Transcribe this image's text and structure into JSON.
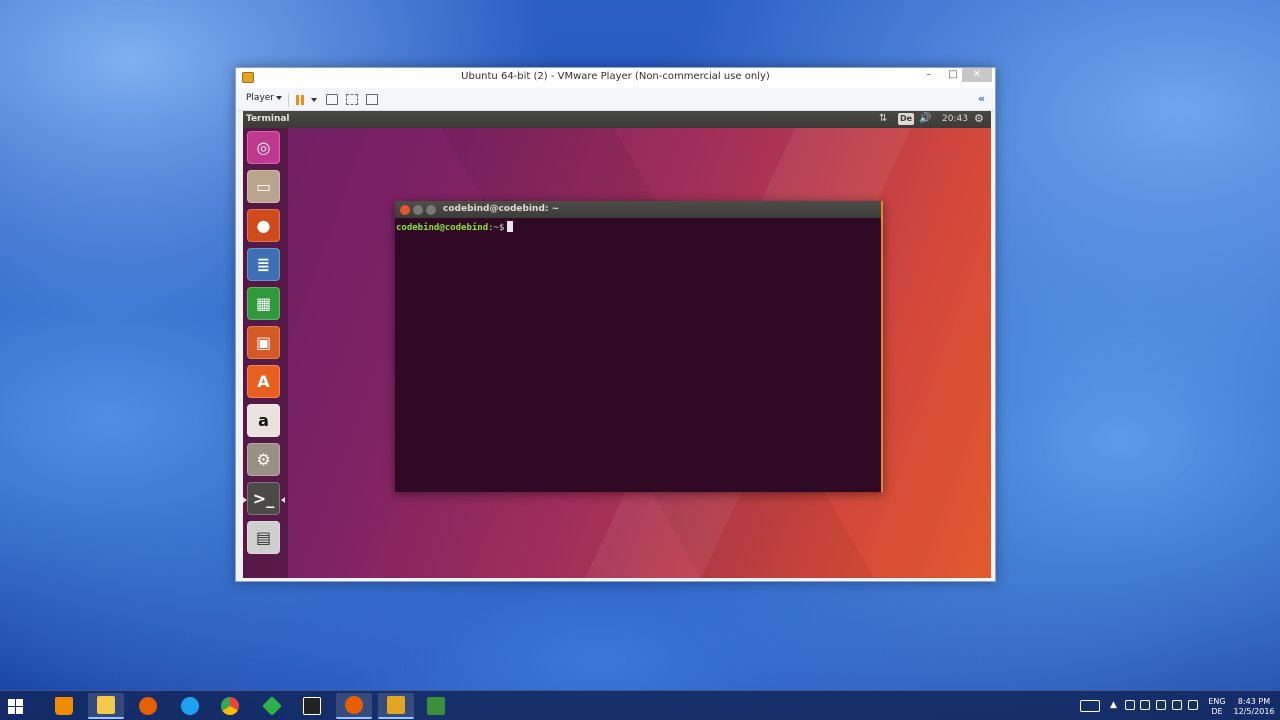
{
  "vmware": {
    "title": "Ubuntu 64-bit (2) - VMware Player (Non-commercial use only)",
    "controls": {
      "minimize": "–",
      "maximize": "□",
      "close": "✕"
    },
    "toolbar": {
      "player_label": "Player",
      "collapse": "«"
    }
  },
  "ubuntu": {
    "panel": {
      "app_title": "Terminal",
      "network": "⇅",
      "keyboard_layout": "De",
      "volume": "🔊",
      "time": "20:43",
      "settings": "⚙"
    },
    "launcher": [
      {
        "name": "dash",
        "glyph": "◎"
      },
      {
        "name": "files",
        "glyph": "▭"
      },
      {
        "name": "firefox",
        "glyph": "●"
      },
      {
        "name": "libreoffice-writer",
        "glyph": "≣"
      },
      {
        "name": "libreoffice-calc",
        "glyph": "▦"
      },
      {
        "name": "libreoffice-impress",
        "glyph": "▣"
      },
      {
        "name": "ubuntu-software",
        "glyph": "A"
      },
      {
        "name": "amazon",
        "glyph": "a"
      },
      {
        "name": "system-settings",
        "glyph": "⚙"
      },
      {
        "name": "terminal",
        "glyph": ">_"
      },
      {
        "name": "floppy",
        "glyph": "▤"
      }
    ],
    "terminal": {
      "title": "codebind@codebind: ~",
      "prompt_user": "codebind@codebind",
      "prompt_path": ":~",
      "prompt_symbol": "$"
    }
  },
  "windows": {
    "taskbar_apps": [
      {
        "name": "vlc",
        "color": "#f08c00"
      },
      {
        "name": "file-explorer",
        "color": "#f2c94c"
      },
      {
        "name": "firefox",
        "color": "#e66000"
      },
      {
        "name": "internet-explorer",
        "color": "#1ea1f2"
      },
      {
        "name": "chrome",
        "color": "#34a853"
      },
      {
        "name": "app-diamond",
        "color": "#2fb14a"
      },
      {
        "name": "app-e",
        "color": "#222222"
      },
      {
        "name": "firefox-2",
        "color": "#e66000"
      },
      {
        "name": "vmware",
        "color": "#e2a625"
      },
      {
        "name": "camtasia",
        "color": "#3a8f3a"
      }
    ],
    "tray": {
      "language_line1": "ENG",
      "language_line2": "DE",
      "time": "8:43 PM",
      "date": "12/5/2016"
    }
  }
}
